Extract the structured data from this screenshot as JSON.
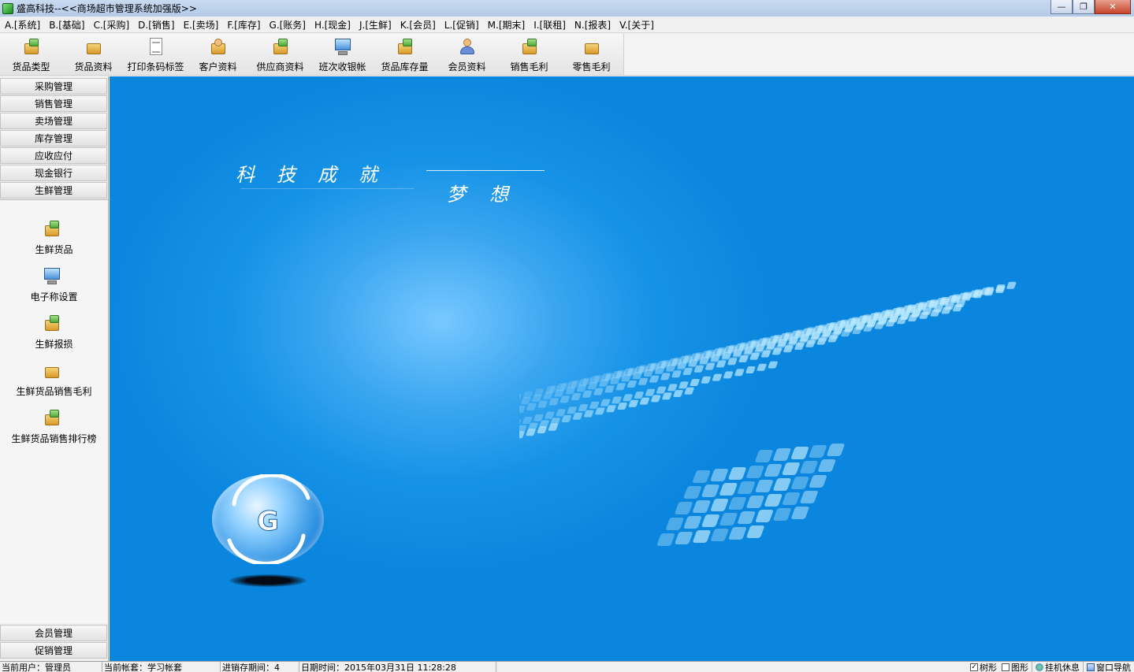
{
  "window": {
    "title": "盛高科技--<<商场超市管理系统加强版>>",
    "minimize": "—",
    "maximize": "❐",
    "close": "✕"
  },
  "menu": [
    "A.[系统]",
    "B.[基础]",
    "C.[采购]",
    "D.[销售]",
    "E.[卖场]",
    "F.[库存]",
    "G.[账务]",
    "H.[现金]",
    "J.[生鲜]",
    "K.[会员]",
    "L.[促销]",
    "M.[期末]",
    "I.[联租]",
    "N.[报表]",
    "V.[关于]"
  ],
  "toolbar": [
    {
      "label": "货品类型",
      "icon": "product-type-icon"
    },
    {
      "label": "货品资料",
      "icon": "product-info-icon"
    },
    {
      "label": "打印条码标签",
      "icon": "print-barcode-icon"
    },
    {
      "label": "客户资料",
      "icon": "customer-icon"
    },
    {
      "label": "供应商资料",
      "icon": "supplier-icon"
    },
    {
      "label": "班次收银帐",
      "icon": "cashier-shift-icon"
    },
    {
      "label": "货品库存量",
      "icon": "inventory-icon"
    },
    {
      "label": "会员资料",
      "icon": "member-icon"
    },
    {
      "label": "销售毛利",
      "icon": "sales-profit-icon"
    },
    {
      "label": "零售毛利",
      "icon": "retail-profit-icon"
    }
  ],
  "sidebar": {
    "top_buttons": [
      "采购管理",
      "销售管理",
      "卖场管理",
      "库存管理",
      "应收应付",
      "现金银行",
      "生鲜管理"
    ],
    "panel_items": [
      {
        "label": "生鲜货品",
        "icon": "fresh-goods-icon"
      },
      {
        "label": "电子称设置",
        "icon": "scale-settings-icon"
      },
      {
        "label": "生鲜报损",
        "icon": "fresh-loss-icon"
      },
      {
        "label": "生鲜货品销售毛利",
        "icon": "fresh-sales-profit-icon"
      },
      {
        "label": "生鲜货品销售排行榜",
        "icon": "fresh-sales-ranking-icon"
      }
    ],
    "bottom_buttons": [
      "会员管理",
      "促销管理"
    ]
  },
  "banner": {
    "slogan_main": "科技成就",
    "slogan_sub": "梦想",
    "logo_letter": "G"
  },
  "status": {
    "user": "当前用户：管理员",
    "account": "当前帐套：学习帐套",
    "period": "进销存期间：4",
    "datetime": "日期时间：2015年03月31日 11:28:28",
    "tree_label": "树形",
    "graphic_label": "图形",
    "tree_checked": "✓",
    "rest_label": "挂机休息",
    "nav_label": "窗口导航"
  },
  "colors": {
    "main_bg": "#1592e6",
    "titlebar": "#b4cbe8"
  }
}
